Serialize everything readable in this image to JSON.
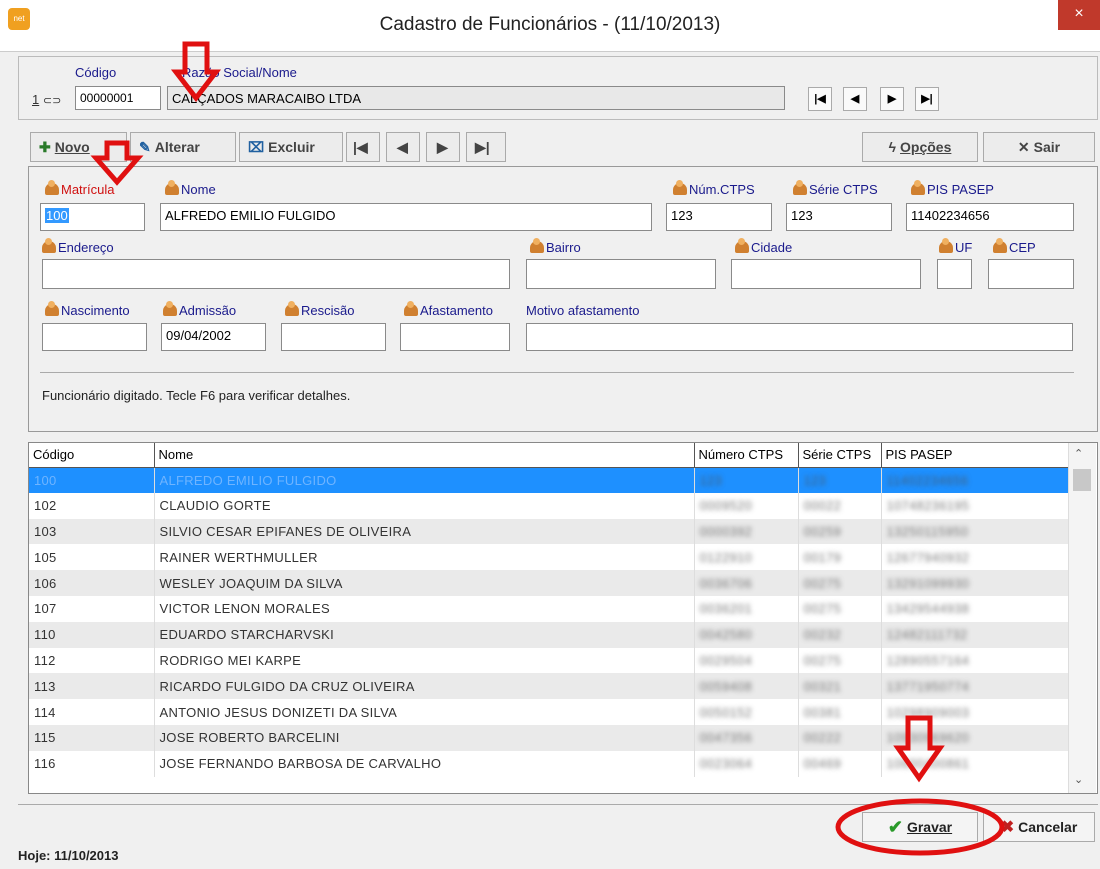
{
  "window": {
    "title": "Cadastro de Funcionários - (11/10/2013)",
    "close": "×",
    "app_icon": "net"
  },
  "company": {
    "code_label": "Código",
    "name_label": "Razão Social/Nome",
    "prefix": "1",
    "code_value": "00000001",
    "name_value": "CALÇADOS MARACAIBO LTDA",
    "nav": [
      "first",
      "prev",
      "next",
      "last"
    ]
  },
  "toolbar": {
    "novo": "Novo",
    "alterar": "Alterar",
    "excluir": "Excluir",
    "opcoes": "Opções",
    "sair": "Sair"
  },
  "form": {
    "matricula_label": "Matrícula",
    "matricula_value": "100",
    "nome_label": "Nome",
    "nome_value": "ALFREDO EMILIO FULGIDO",
    "ctps_label": "Núm.CTPS",
    "ctps_value": "123",
    "serie_label": "Série CTPS",
    "serie_value": "123",
    "pis_label": "PIS PASEP",
    "pis_value": "11402234656",
    "endereco_label": "Endereço",
    "endereco_value": "",
    "bairro_label": "Bairro",
    "bairro_value": "",
    "cidade_label": "Cidade",
    "cidade_value": "",
    "uf_label": "UF",
    "uf_value": "",
    "cep_label": "CEP",
    "cep_value": "",
    "nascimento_label": "Nascimento",
    "nascimento_value": "",
    "admissao_label": "Admissão",
    "admissao_value": "09/04/2002",
    "rescisao_label": "Rescisão",
    "rescisao_value": "",
    "afastamento_label": "Afastamento",
    "afastamento_value": "",
    "motivo_label": "Motivo afastamento",
    "motivo_value": "",
    "message": "Funcionário digitado. Tecle F6 para verificar detalhes."
  },
  "grid": {
    "headers": [
      "Código",
      "Nome",
      "Número CTPS",
      "Série CTPS",
      "PIS PASEP"
    ],
    "rows": [
      [
        "100",
        "ALFREDO EMILIO FULGIDO",
        "123",
        "123",
        "11402234656"
      ],
      [
        "102",
        "CLAUDIO GORTE",
        "0009520",
        "00022",
        "10748236195"
      ],
      [
        "103",
        "SILVIO CESAR EPIFANES DE OLIVEIRA",
        "0000392",
        "00259",
        "13250115950"
      ],
      [
        "105",
        "RAINER WERTHMULLER",
        "0122910",
        "00179",
        "12677940932"
      ],
      [
        "106",
        "WESLEY JOAQUIM DA SILVA",
        "0036706",
        "00275",
        "13291099930"
      ],
      [
        "107",
        "VICTOR LENON MORALES",
        "0036201",
        "00275",
        "13429544938"
      ],
      [
        "110",
        "EDUARDO STARCHARVSKI",
        "0042580",
        "00232",
        "12482111732"
      ],
      [
        "112",
        "RODRIGO MEI KARPE",
        "0029504",
        "00275",
        "12890557164"
      ],
      [
        "113",
        "RICARDO FULGIDO DA CRUZ OLIVEIRA",
        "0059408",
        "00321",
        "13771950774"
      ],
      [
        "114",
        "ANTONIO JESUS DONIZETI DA SILVA",
        "0050152",
        "00381",
        "10298909003"
      ],
      [
        "115",
        "JOSE ROBERTO BARCELINI",
        "0047356",
        "00222",
        "10930969620"
      ],
      [
        "116",
        "JOSE FERNANDO BARBOSA DE CARVALHO",
        "0023064",
        "00469",
        "10600400861"
      ]
    ]
  },
  "actions": {
    "gravar": "Gravar",
    "cancelar": "Cancelar"
  },
  "status": {
    "hoje_label": "Hoje:",
    "hoje_value": "11/10/2013"
  },
  "colors": {
    "title_blue": "#1a1a8c",
    "required_red": "#d01010",
    "selection": "#1e90ff",
    "annotation_red": "#e01010"
  }
}
